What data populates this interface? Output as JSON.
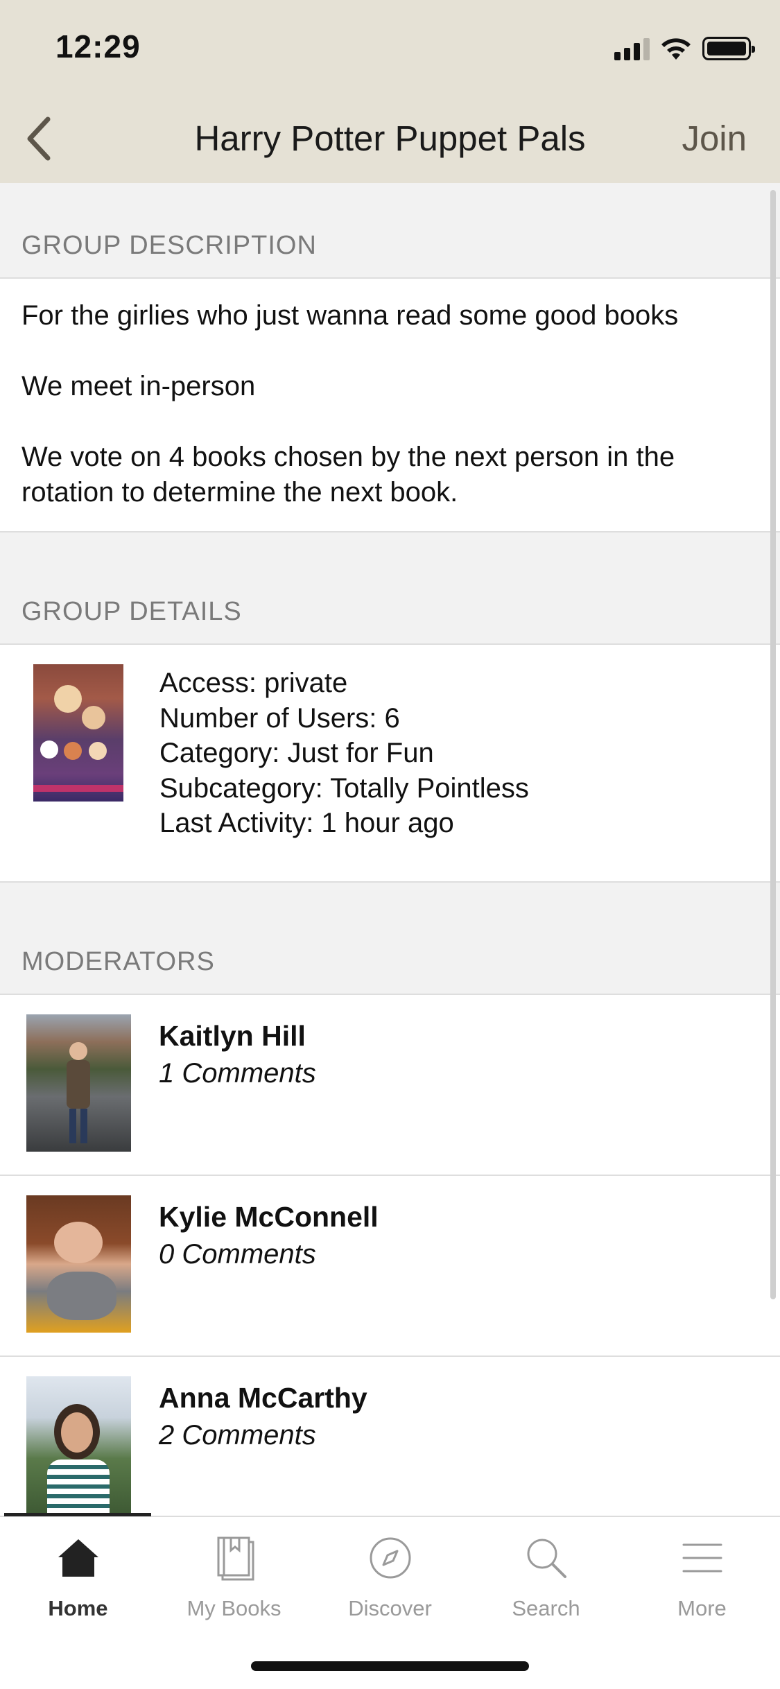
{
  "status_bar": {
    "time": "12:29"
  },
  "header": {
    "title": "Harry Potter Puppet Pals",
    "join_label": "Join"
  },
  "description": {
    "heading": "GROUP DESCRIPTION",
    "paragraphs": [
      "For the girlies who just wanna read some good books",
      "We meet in-person",
      "We vote on 4 books chosen by the next person in the rotation to determine the next book."
    ]
  },
  "details": {
    "heading": "GROUP DETAILS",
    "access": "Access: private",
    "users": "Number of Users: 6",
    "category": "Category: Just for Fun",
    "subcategory": "Subcategory: Totally Pointless",
    "last_activity": "Last Activity: 1 hour ago"
  },
  "moderators": {
    "heading": "MODERATORS",
    "items": [
      {
        "name": "Kaitlyn Hill",
        "comments": "1 Comments"
      },
      {
        "name": "Kylie McConnell",
        "comments": "0 Comments"
      },
      {
        "name": "Anna McCarthy",
        "comments": "2 Comments"
      }
    ]
  },
  "tabbar": {
    "items": [
      {
        "label": "Home",
        "icon": "home-icon",
        "active": true
      },
      {
        "label": "My Books",
        "icon": "books-icon",
        "active": false
      },
      {
        "label": "Discover",
        "icon": "compass-icon",
        "active": false
      },
      {
        "label": "Search",
        "icon": "search-icon",
        "active": false
      },
      {
        "label": "More",
        "icon": "menu-icon",
        "active": false
      }
    ]
  },
  "colors": {
    "header_bg": "#e5e1d5",
    "section_bg": "#f2f2f2",
    "accent": "#5d564a"
  }
}
